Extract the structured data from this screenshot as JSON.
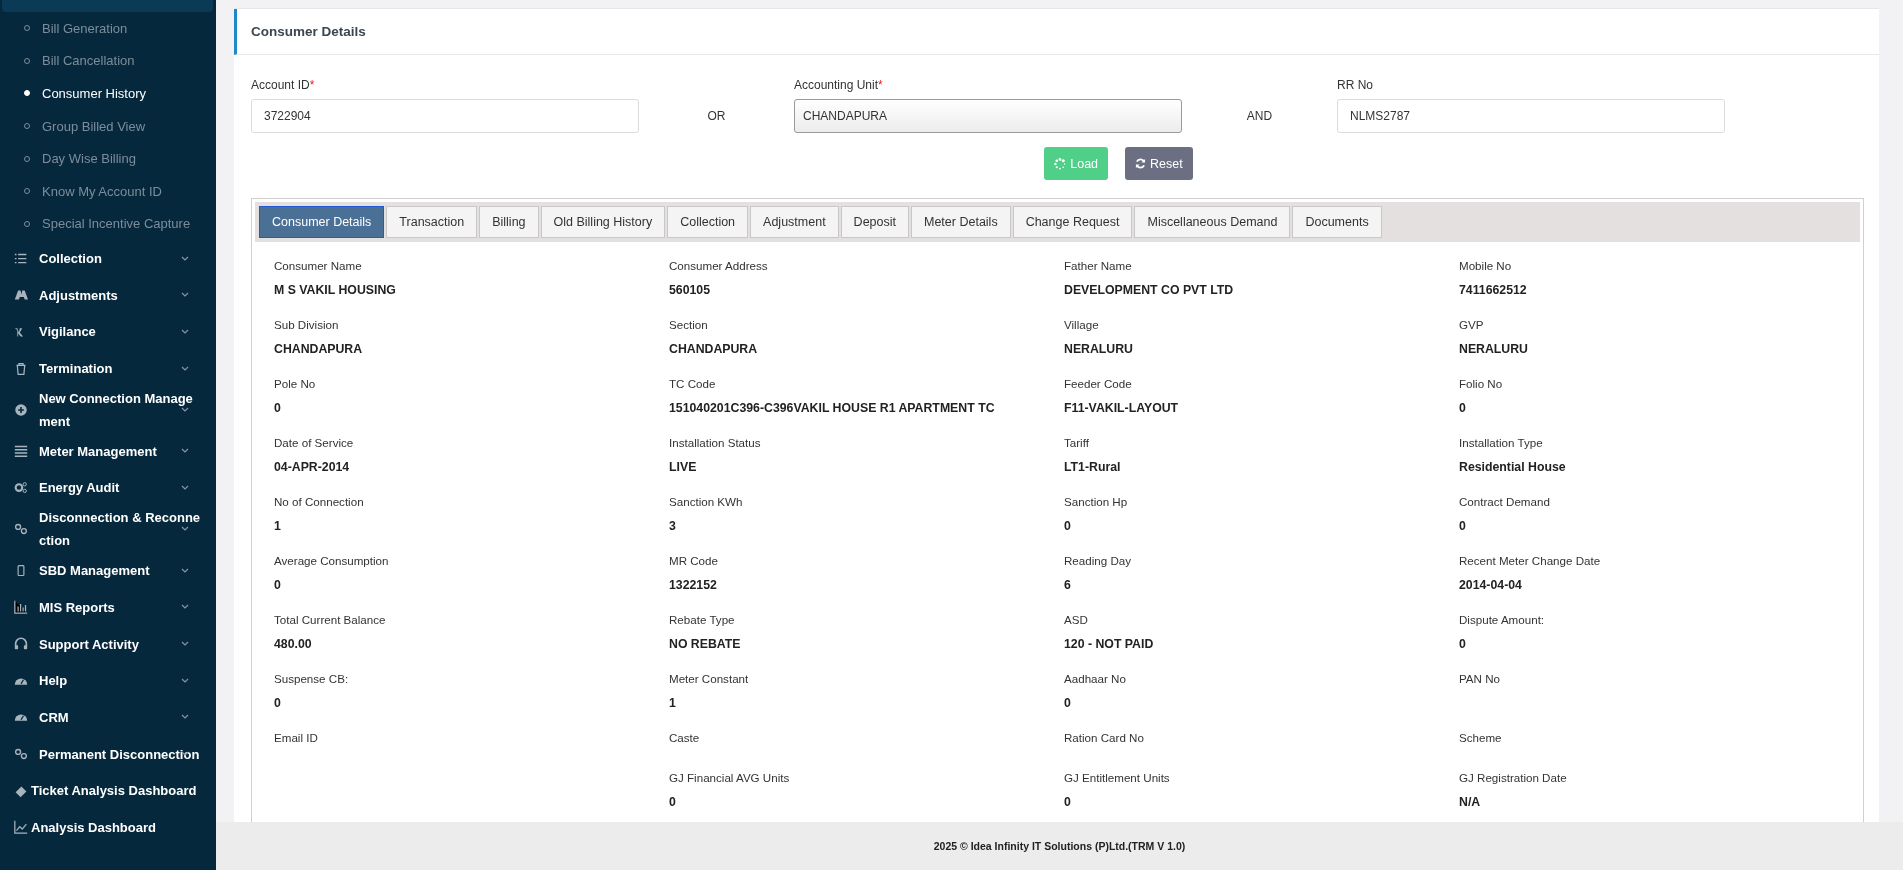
{
  "sidebar": {
    "sub_items": [
      {
        "label": "Bill Generation",
        "selected": false
      },
      {
        "label": "Bill Cancellation",
        "selected": false
      },
      {
        "label": "Consumer History",
        "selected": true
      },
      {
        "label": "Group Billed View",
        "selected": false
      },
      {
        "label": "Day Wise Billing",
        "selected": false
      },
      {
        "label": "Know My Account ID",
        "selected": false
      },
      {
        "label": "Special Incentive Capture",
        "selected": false
      }
    ],
    "items": [
      {
        "label": "Collection",
        "expandable": true
      },
      {
        "label": "Adjustments",
        "expandable": true
      },
      {
        "label": "Vigilance",
        "expandable": true
      },
      {
        "label": "Termination",
        "expandable": true
      },
      {
        "label": "New Connection Management",
        "expandable": true
      },
      {
        "label": "Meter Management",
        "expandable": true
      },
      {
        "label": "Energy Audit",
        "expandable": true
      },
      {
        "label": "Disconnection & Reconnection",
        "expandable": true
      },
      {
        "label": "SBD Management",
        "expandable": true
      },
      {
        "label": "MIS Reports",
        "expandable": true
      },
      {
        "label": "Support Activity",
        "expandable": true
      },
      {
        "label": "Help",
        "expandable": true
      },
      {
        "label": "CRM",
        "expandable": true
      },
      {
        "label": "Permanent Disconnection",
        "expandable": true
      },
      {
        "label": "Ticket Analysis Dashboard",
        "expandable": false
      },
      {
        "label": "Analysis Dashboard",
        "expandable": false
      }
    ]
  },
  "card": {
    "title": "Consumer Details",
    "form": {
      "account_id": {
        "label": "Account ID",
        "required_mark": "*",
        "value": "3722904"
      },
      "separator_1": "OR",
      "accounting_unit": {
        "label": "Accounting Unit",
        "required_mark": "*",
        "value": "CHANDAPURA"
      },
      "separator_2": "AND",
      "rr_no": {
        "label": "RR No",
        "value": "NLMS2787"
      },
      "buttons": [
        {
          "kind": "load",
          "label": "Load"
        },
        {
          "kind": "reset",
          "label": "Reset"
        }
      ]
    },
    "tabs": [
      {
        "label": "Consumer Details",
        "selected": true
      },
      {
        "label": "Transaction",
        "selected": false
      },
      {
        "label": "Billing",
        "selected": false
      },
      {
        "label": "Old Billing History",
        "selected": false
      },
      {
        "label": "Collection",
        "selected": false
      },
      {
        "label": "Adjustment",
        "selected": false
      },
      {
        "label": "Deposit",
        "selected": false
      },
      {
        "label": "Meter Details",
        "selected": false
      },
      {
        "label": "Change Request",
        "selected": false
      },
      {
        "label": "Miscellaneous Demand",
        "selected": false
      },
      {
        "label": "Documents",
        "selected": false
      }
    ],
    "details_columns": [
      {
        "fields": [
          {
            "label": "Consumer Name",
            "value": "M S VAKIL HOUSING"
          },
          {
            "label": "Sub Division",
            "value": "CHANDAPURA"
          },
          {
            "label": "Pole No",
            "value": "0"
          },
          {
            "label": "Date of Service",
            "value": "04-APR-2014"
          },
          {
            "label": "No of Connection",
            "value": "1"
          },
          {
            "label": "Average Consumption",
            "value": "0"
          },
          {
            "label": "Total Current Balance",
            "value": "480.00"
          },
          {
            "label": "Suspense CB:",
            "value": "0"
          },
          {
            "label": "Email ID"
          }
        ]
      },
      {
        "fields": [
          {
            "label": "Consumer Address",
            "value": "560105"
          },
          {
            "label": "Section",
            "value": "CHANDAPURA"
          },
          {
            "label": "TC Code",
            "value": "151040201C396-C396VAKIL HOUSE R1 APARTMENT TC"
          },
          {
            "label": "Installation Status",
            "value": "LIVE"
          },
          {
            "label": "Sanction KWh",
            "value": "3"
          },
          {
            "label": "MR Code",
            "value": "1322152"
          },
          {
            "label": "Rebate Type",
            "value": "NO REBATE"
          },
          {
            "label": "Meter Constant",
            "value": "1"
          },
          {
            "label": "Caste"
          },
          {
            "label": "GJ Financial AVG Units",
            "value": "0"
          }
        ]
      },
      {
        "fields": [
          {
            "label": "Father Name",
            "value": "DEVELOPMENT CO PVT LTD"
          },
          {
            "label": "Village",
            "value": "NERALURU"
          },
          {
            "label": "Feeder Code",
            "value": "F11-VAKIL-LAYOUT"
          },
          {
            "label": "Tariff",
            "value": "LT1-Rural"
          },
          {
            "label": "Sanction Hp",
            "value": "0"
          },
          {
            "label": "Reading Day",
            "value": "6"
          },
          {
            "label": "ASD",
            "value": "120 - NOT PAID"
          },
          {
            "label": "Aadhaar No",
            "value": "0"
          },
          {
            "label": "Ration Card No"
          },
          {
            "label": "GJ Entitlement Units",
            "value": "0"
          }
        ]
      },
      {
        "fields": [
          {
            "label": "Mobile No",
            "value": "7411662512"
          },
          {
            "label": "GVP",
            "value": "NERALURU"
          },
          {
            "label": "Folio No",
            "value": "0"
          },
          {
            "label": "Installation Type",
            "value": "Residential House"
          },
          {
            "label": "Contract Demand",
            "value": "0"
          },
          {
            "label": "Recent Meter Change Date",
            "value": "2014-04-04"
          },
          {
            "label": "Dispute Amount:",
            "value": "0"
          },
          {
            "label": "PAN No"
          },
          {
            "label": "Scheme"
          },
          {
            "label": "GJ Registration Date",
            "value": "N/A"
          }
        ]
      }
    ]
  },
  "footer": "2025 © Idea Infinity IT Solutions (P)Ltd.(TRM V 1.0)"
}
